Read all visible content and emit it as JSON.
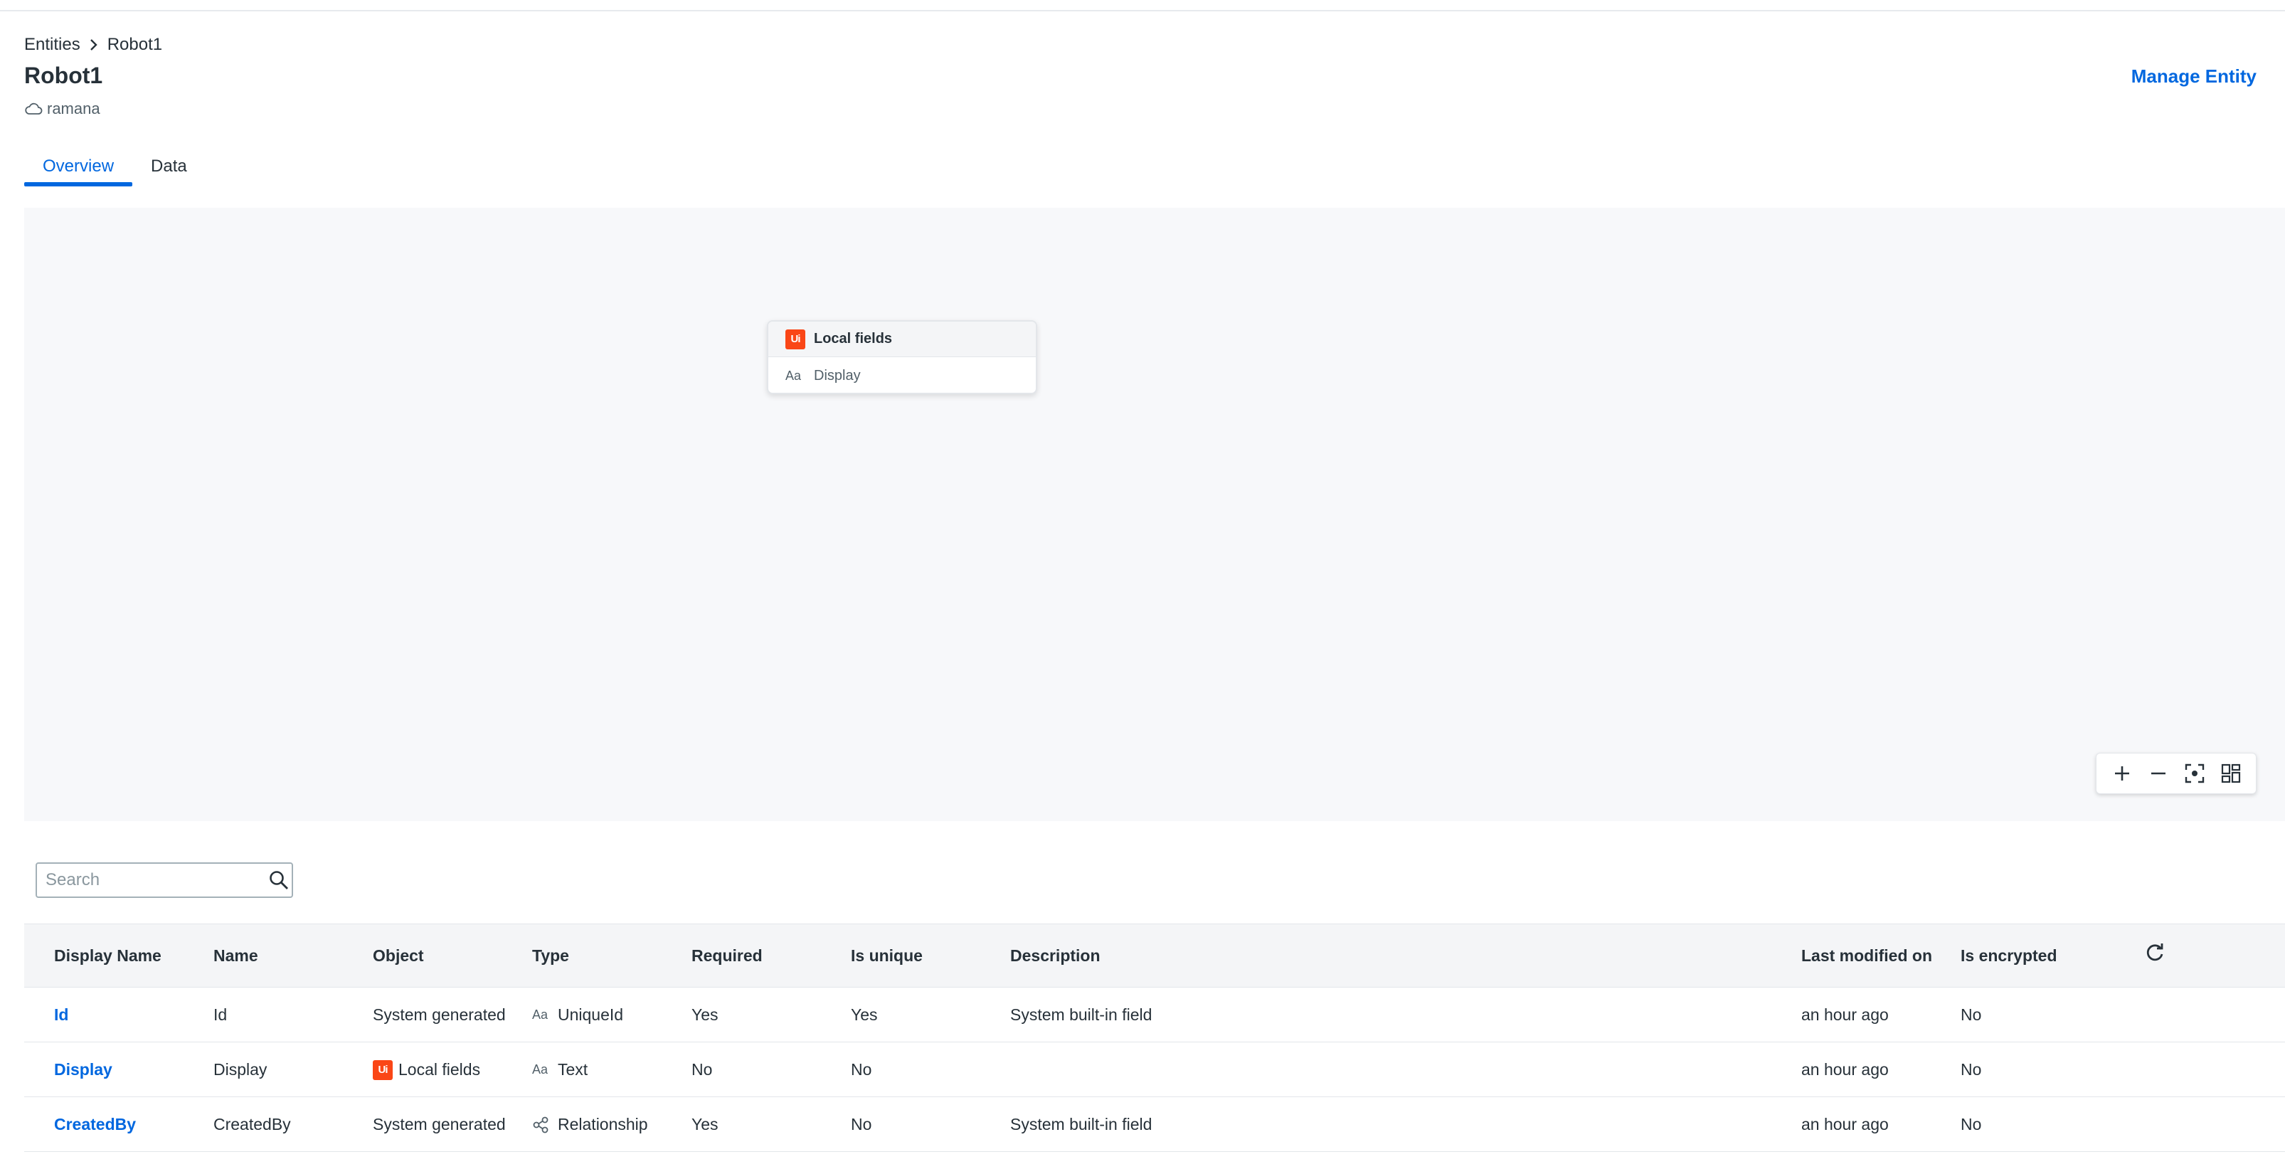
{
  "breadcrumb": {
    "root": "Entities",
    "current": "Robot1"
  },
  "page": {
    "title": "Robot1",
    "tenant": "ramana",
    "manage_label": "Manage Entity"
  },
  "tabs": [
    {
      "label": "Overview",
      "active": true
    },
    {
      "label": "Data",
      "active": false
    }
  ],
  "canvas": {
    "node": {
      "logo": "Ui",
      "title": "Local fields",
      "field_icon": "Aa",
      "field": "Display"
    }
  },
  "zoom_controls": [
    "zoom-in-icon",
    "zoom-out-icon",
    "fit-view-icon",
    "grid-layout-icon"
  ],
  "search": {
    "placeholder": "Search",
    "value": ""
  },
  "table": {
    "headers": [
      "Display Name",
      "Name",
      "Object",
      "Type",
      "Required",
      "Is unique",
      "Description",
      "Last modified on",
      "Is encrypted"
    ],
    "rows": [
      {
        "display_name": "Id",
        "name": "Id",
        "object": "System generated",
        "object_logo": "",
        "type_icon": "Aa",
        "type": "UniqueId",
        "required": "Yes",
        "unique": "Yes",
        "description": "System built-in field",
        "modified": "an hour ago",
        "encrypted": "No"
      },
      {
        "display_name": "Display",
        "name": "Display",
        "object": "Local fields",
        "object_logo": "Ui",
        "type_icon": "Aa",
        "type": "Text",
        "required": "No",
        "unique": "No",
        "description": "",
        "modified": "an hour ago",
        "encrypted": "No"
      },
      {
        "display_name": "CreatedBy",
        "name": "CreatedBy",
        "object": "System generated",
        "object_logo": "",
        "type_icon": "relationship-icon",
        "type": "Relationship",
        "required": "Yes",
        "unique": "No",
        "description": "System built-in field",
        "modified": "an hour ago",
        "encrypted": "No"
      }
    ]
  },
  "colors": {
    "accent": "#0067df",
    "brand": "#fa4616",
    "canvas_bg": "#f7f8fa"
  }
}
